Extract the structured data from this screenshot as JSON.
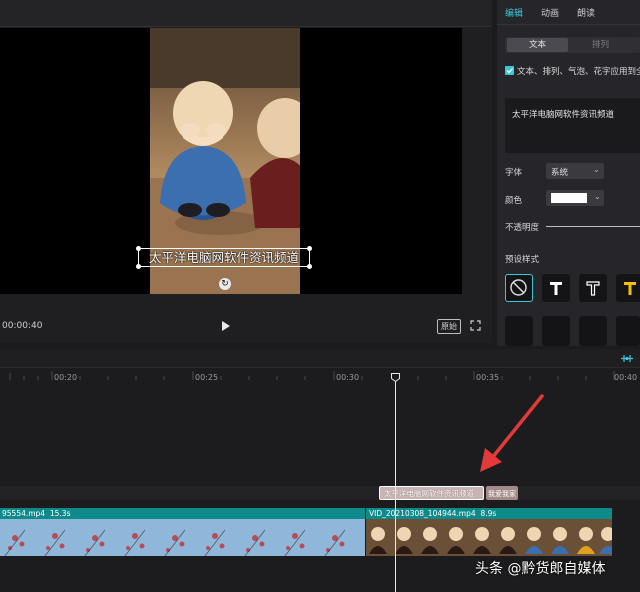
{
  "preview": {
    "caption": "太平洋电脑网软件资讯频道",
    "current_time": "00:00:40",
    "ratio_label": "原始"
  },
  "inspector": {
    "tabs": [
      "编辑",
      "动画",
      "朗读"
    ],
    "segments": [
      "文本",
      "排列"
    ],
    "apply_all_label": "文本、排列、气泡、花字应用到全部",
    "text_value": "太平洋电脑网软件资讯频道",
    "font_label": "字体",
    "font_value": "系统",
    "color_label": "颜色",
    "color_value": "#ffffff",
    "opacity_label": "不透明度",
    "presets_label": "预设样式",
    "preset_icons": [
      "none-icon",
      "text-style-white-icon",
      "text-style-outline-icon",
      "text-style-yellow-icon"
    ],
    "accent_color": "#3cc6d8"
  },
  "timeline": {
    "ticks": [
      "00:20",
      "00:25",
      "00:30",
      "00:35",
      "00:40"
    ],
    "text_clip_label": "太平洋电脑网软件资讯频道",
    "text_clip2_label": "我爱我家",
    "video_clips": [
      {
        "name": "95554.mp4",
        "duration": "15.3s"
      },
      {
        "name": "VID_20210308_104944.mp4",
        "duration": "8.9s"
      }
    ]
  },
  "watermark": "头条 @黔货郎自媒体"
}
